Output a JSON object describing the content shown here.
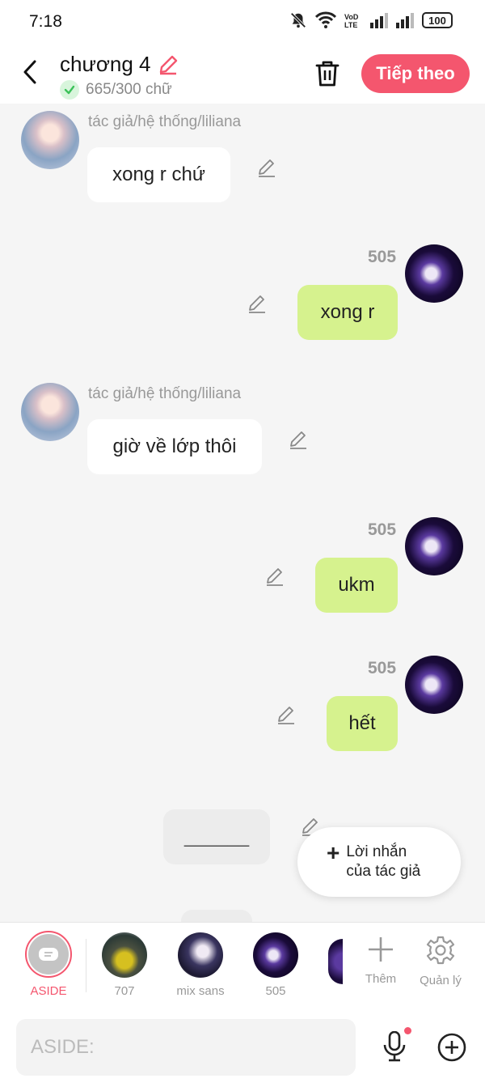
{
  "status_bar": {
    "time": "7:18",
    "battery": "100"
  },
  "header": {
    "title": "chương 4",
    "word_count": "665/300 chữ",
    "next_label": "Tiếp theo"
  },
  "messages": [
    {
      "sender": "tác giả/hệ thống/liliana",
      "text": "xong r chứ"
    },
    {
      "sender": "505",
      "text": "xong r"
    },
    {
      "sender": "tác giả/hệ thống/liliana",
      "text": "giờ về lớp thôi"
    },
    {
      "sender": "505",
      "text": "ukm"
    },
    {
      "sender": "505",
      "text": "hết"
    },
    {
      "sender": "",
      "text": "______"
    }
  ],
  "author_note": {
    "line1": "Lời nhắn",
    "line2": "của tác giả"
  },
  "characters": [
    {
      "label": "ASIDE",
      "color": "#f4566e"
    },
    {
      "label": "707"
    },
    {
      "label": "mix sans"
    },
    {
      "label": "505"
    }
  ],
  "tools": [
    {
      "label": "Thêm",
      "icon": "plus-icon"
    },
    {
      "label": "Quản lý",
      "icon": "gear-icon"
    }
  ],
  "input": {
    "placeholder": "ASIDE:"
  },
  "colors": {
    "accent": "#f4566e",
    "right_bubble": "#d6f28e",
    "left_bubble": "#ffffff"
  }
}
